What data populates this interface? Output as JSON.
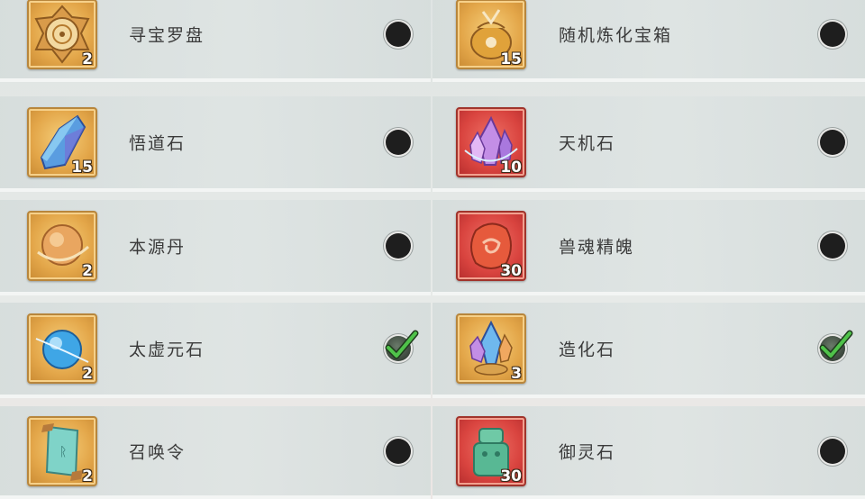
{
  "left_items": [
    {
      "name": "寻宝罗盘",
      "count": "2",
      "checked": false,
      "frame": "gold",
      "icon": "compass-icon"
    },
    {
      "name": "悟道石",
      "count": "15",
      "checked": false,
      "frame": "gold",
      "icon": "blue-crystal-icon"
    },
    {
      "name": "本源丹",
      "count": "2",
      "checked": false,
      "frame": "gold",
      "icon": "orb-pill-icon"
    },
    {
      "name": "太虚元石",
      "count": "2",
      "checked": true,
      "frame": "gold",
      "icon": "blue-orb-icon"
    },
    {
      "name": "召唤令",
      "count": "2",
      "checked": false,
      "frame": "gold",
      "icon": "summon-scroll-icon"
    }
  ],
  "right_items": [
    {
      "name": "随机炼化宝箱",
      "count": "15",
      "checked": false,
      "frame": "gold",
      "icon": "treasure-bag-icon"
    },
    {
      "name": "天机石",
      "count": "10",
      "checked": false,
      "frame": "red",
      "icon": "purple-crystal-icon"
    },
    {
      "name": "兽魂精魄",
      "count": "30",
      "checked": false,
      "frame": "red",
      "icon": "beast-soul-icon"
    },
    {
      "name": "造化石",
      "count": "3",
      "checked": true,
      "frame": "gold",
      "icon": "creation-crystal-icon"
    },
    {
      "name": "御灵石",
      "count": "30",
      "checked": false,
      "frame": "red",
      "icon": "jade-stone-icon"
    }
  ],
  "colors": {
    "check": "#4fc24a",
    "toggle_off": "#1e1e1e",
    "gold_frame": "#e3a649",
    "red_frame": "#d9443f"
  }
}
